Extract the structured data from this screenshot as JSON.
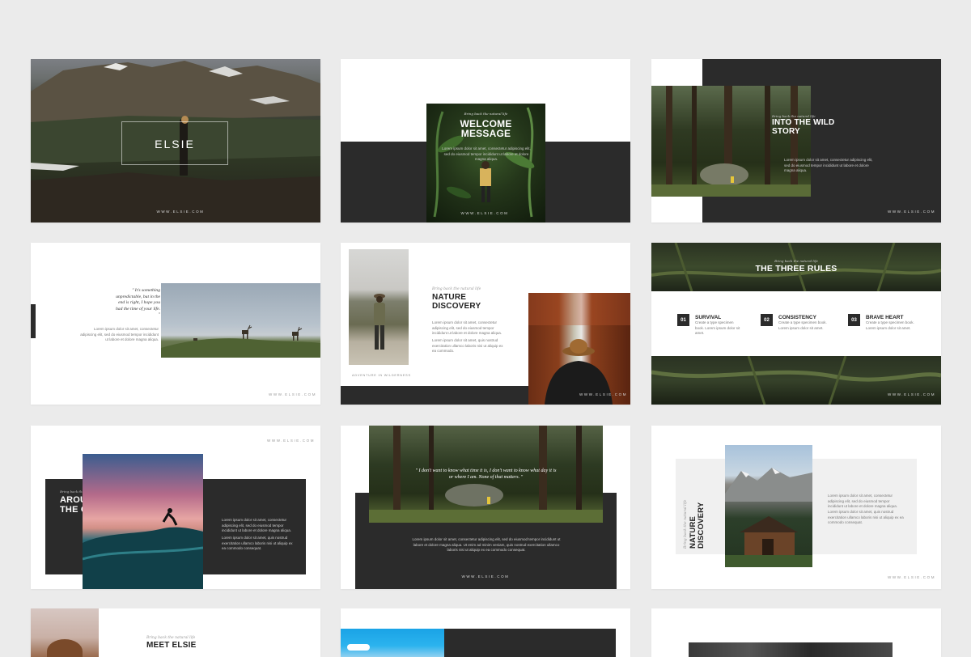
{
  "colors": {
    "background": "#ebebeb",
    "dark_panel": "#2b2b2b",
    "slide_bg": "#ffffff"
  },
  "slide1": {
    "title": "ELSIE",
    "site": "WWW.ELSIE.COM"
  },
  "slide2": {
    "kicker": "Bring back the natural life",
    "title_line1": "WELCOME",
    "title_line2": "MESSAGE",
    "body": "Lorem ipsum dolor sit amet, consectetur adipiscing elit, sed do eiusmod tempor incididunt ut labore et dolore magna aliqua.",
    "site": "WWW.ELSIE.COM"
  },
  "slide3": {
    "kicker": "Bring back the natural life",
    "title_line1": "INTO THE WILD",
    "title_line2": "STORY",
    "body": "Lorem ipsum dolor sit amet, consectetur adipiscing elit, sed do eiusmod tempor incididunt ut labore et dolore magna aliqua.",
    "site": "WWW.ELSIE.COM"
  },
  "slide4": {
    "quote": "\" It's something unpredictable, but in the end is right, I hope you had the time of your life. \"",
    "body": "Lorem ipsum dolor sit amet, consectetur adipiscing elit, sed do eiusmod tempor incididunt ut labore et dolore magna aliqua.",
    "site": "WWW.ELSIE.COM"
  },
  "slide5": {
    "kicker": "Bring back the natural life",
    "title_line1": "NATURE",
    "title_line2": "DISCOVERY",
    "body1": "Lorem ipsum dolor sit amet, consectetur adipiscing elit, sed do eiusmod tempor incididunt ut labore et dolore magna aliqua.",
    "body2": "Lorem ipsum dolor sit amet, quis nostrud exercitation ullamco laboris nisi ut aliquip ex ea commodo.",
    "caption": "ADVENTURE IN WILDERNESS",
    "site": "WWW.ELSIE.COM"
  },
  "slide6": {
    "kicker": "Bring back the natural life",
    "title": "THE THREE RULES",
    "rules": [
      {
        "num": "01",
        "name": "SURVIVAL",
        "desc": "Create a type specimen book. Lorem ipsum dolor sit amet."
      },
      {
        "num": "02",
        "name": "CONSISTENCY",
        "desc": "Create a type specimen book. Lorem ipsum dolor sit amet."
      },
      {
        "num": "03",
        "name": "BRAVE HEART",
        "desc": "Create a type specimen book. Lorem ipsum dolor sit amet."
      }
    ],
    "site": "WWW.ELSIE.COM"
  },
  "slide7": {
    "site": "WWW.ELSIE.COM",
    "kicker": "Bring back the natural life",
    "title_line1": "AROUND",
    "title_line2": "THE OCEAN",
    "body1": "Lorem ipsum dolor sit amet, consectetur adipiscing elit, sed do eiusmod tempor incididunt ut labore et dolore magna aliqua.",
    "body2": "Lorem ipsum dolor sit amet, quis nostrud exercitation ullamco laboris nisi ut aliquip ex ea commodo consequat."
  },
  "slide8": {
    "quote": "\" I don't want to know what time it is, I don't want to know what day it is or where I am. None of that matters. \"",
    "body": "Lorem ipsum dolor sit amet, consectetur adipiscing elit, sed do eiusmod tempor incididunt ut labore et dolore magna aliqua. Ut enim ad minim veniam, quis nostrud exercitation ullamco laboris nisi ut aliquip ex ea commodo consequat.",
    "site": "WWW.ELSIE.COM"
  },
  "slide9": {
    "kicker": "Bring back the natural life",
    "title_line1": "NATURE",
    "title_line2": "DISCOVERY",
    "body1": "Lorem ipsum dolor sit amet, consectetur adipiscing elit, sed do eiusmod tempor incididunt ut labore et dolore magna aliqua.",
    "body2": "Lorem ipsum dolor sit amet, quis nostrud exercitation ullamco laboris nisi ut aliquip ex ea commodo consequat.",
    "site": "WWW.ELSIE.COM"
  },
  "slide10": {
    "kicker": "Bring back the natural life",
    "title": "MEET ELSIE"
  }
}
